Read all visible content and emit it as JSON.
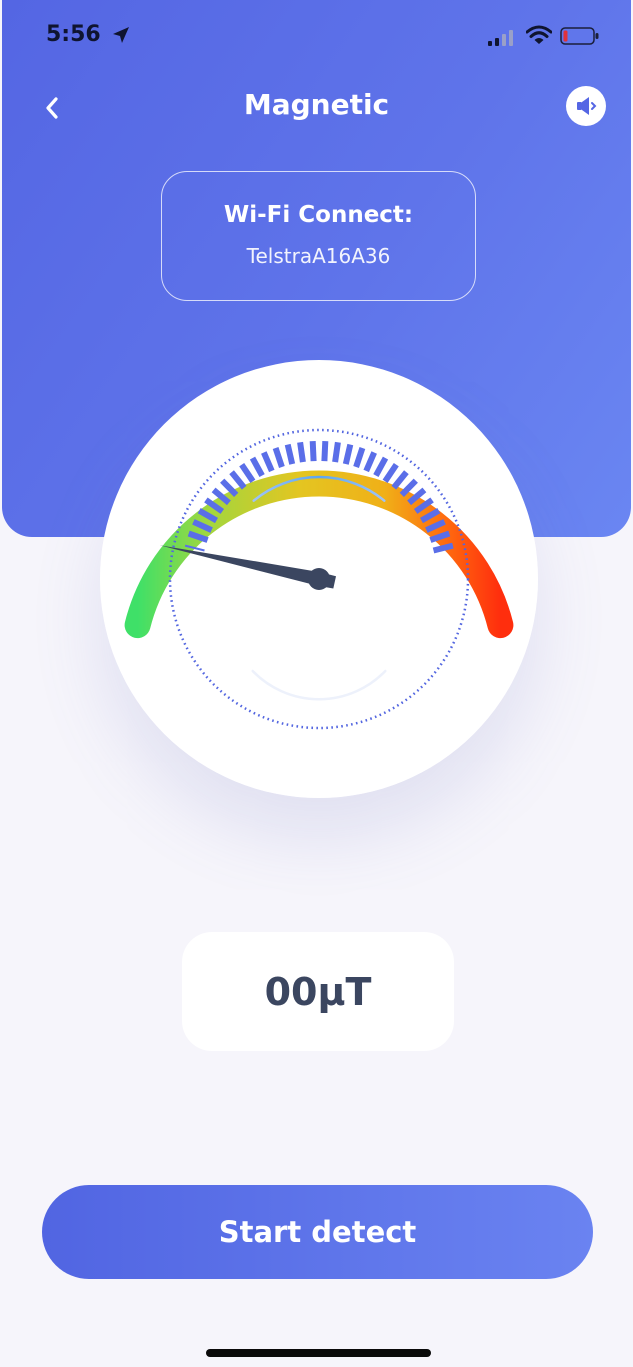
{
  "status_bar": {
    "time": "5:56",
    "icons": [
      "location-arrow-icon",
      "cellular-signal-icon",
      "wifi-icon",
      "battery-low-icon"
    ]
  },
  "header": {
    "title": "Magnetic",
    "back_icon": "chevron-left-icon",
    "action_icon": "speaker-icon"
  },
  "wifi": {
    "label": "Wi-Fi Connect:",
    "ssid": "TelstraA16A36"
  },
  "gauge": {
    "needle_level": 0.03,
    "scale_colors": [
      "#3fe068",
      "#e4c521",
      "#ff3a0d"
    ]
  },
  "reading": {
    "value": "00μT"
  },
  "actions": {
    "start_label": "Start detect"
  },
  "colors": {
    "accent": "#5b6de6",
    "background": "#f6f5fb",
    "reading_text": "#3b4660",
    "needle": "#3b4660"
  }
}
